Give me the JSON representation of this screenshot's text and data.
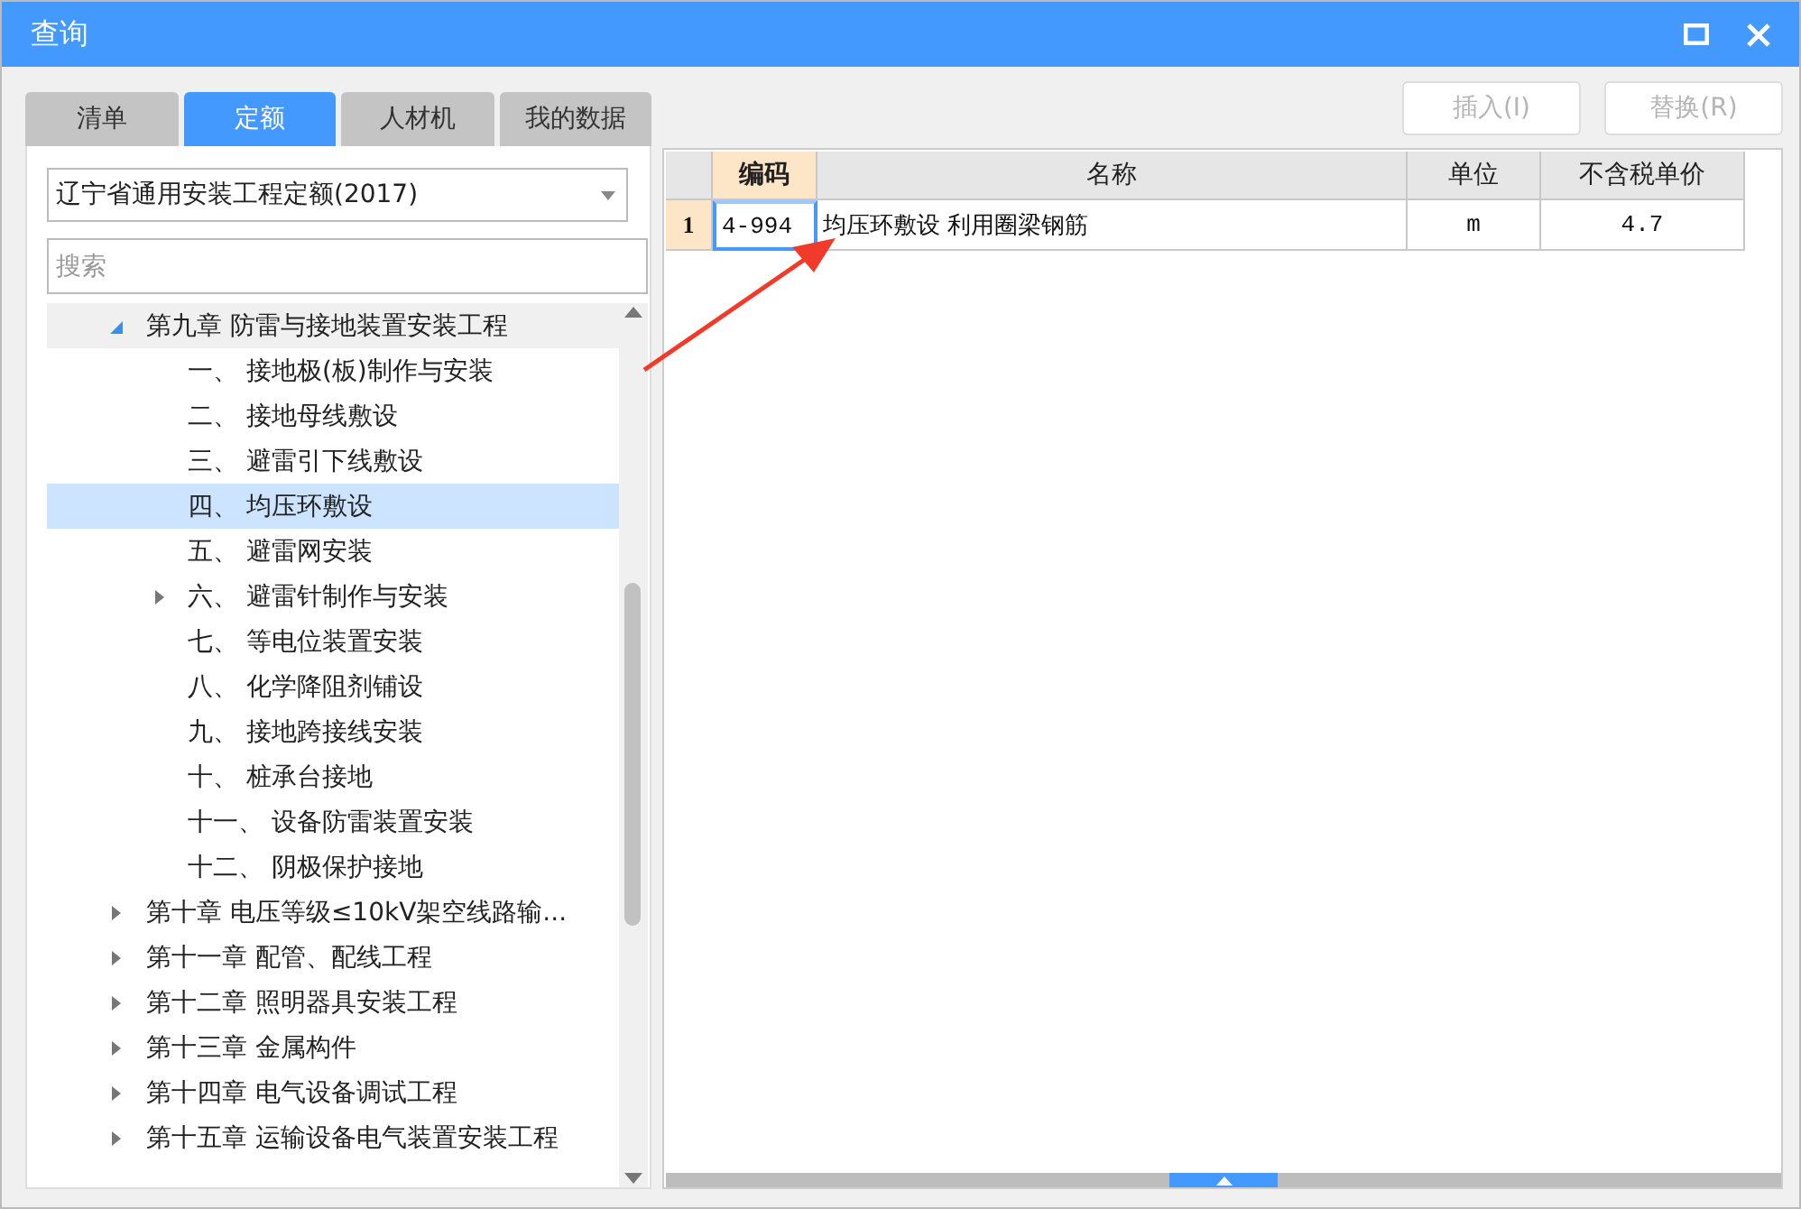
{
  "window": {
    "title": "查询"
  },
  "tabs": [
    {
      "label": "清单",
      "selected": false
    },
    {
      "label": "定额",
      "selected": true
    },
    {
      "label": "人材机",
      "selected": false
    },
    {
      "label": "我的数据",
      "selected": false
    }
  ],
  "buttons": [
    {
      "label": "插入(I)",
      "disabled": true
    },
    {
      "label": "替换(R)",
      "disabled": true
    }
  ],
  "library": {
    "value": "辽宁省通用安装工程定额(2017)"
  },
  "search": {
    "placeholder": "搜索"
  },
  "tree": [
    {
      "label": "第九章 防雷与接地装置安装工程",
      "expanded": true,
      "selected": false,
      "children": [
        {
          "label": "一、 接地极(板)制作与安装",
          "selected": false
        },
        {
          "label": "二、 接地母线敷设",
          "selected": false
        },
        {
          "label": "三、 避雷引下线敷设",
          "selected": false
        },
        {
          "label": "四、 均压环敷设",
          "selected": true
        },
        {
          "label": "五、 避雷网安装",
          "selected": false
        },
        {
          "label": "六、 避雷针制作与安装",
          "selected": false,
          "expanded": false
        },
        {
          "label": "七、 等电位装置安装",
          "selected": false
        },
        {
          "label": "八、 化学降阻剂铺设",
          "selected": false
        },
        {
          "label": "九、 接地跨接线安装",
          "selected": false
        },
        {
          "label": "十、 桩承台接地",
          "selected": false
        },
        {
          "label": "十一、 设备防雷装置安装",
          "selected": false
        },
        {
          "label": "十二、 阴极保护接地",
          "selected": false
        }
      ]
    },
    {
      "label": "第十章 电压等级≤10kV架空线路输...",
      "expanded": false,
      "selected": false
    },
    {
      "label": "第十一章 配管、配线工程",
      "expanded": false,
      "selected": false
    },
    {
      "label": "第十二章 照明器具安装工程",
      "expanded": false,
      "selected": false
    },
    {
      "label": "第十三章 金属构件",
      "expanded": false,
      "selected": false
    },
    {
      "label": "第十四章 电气设备调试工程",
      "expanded": false,
      "selected": false
    },
    {
      "label": "第十五章 运输设备电气装置安装工程",
      "expanded": false,
      "selected": false
    }
  ],
  "table": {
    "columns": [
      "编码",
      "名称",
      "单位",
      "不含税单价"
    ],
    "rows": [
      {
        "index": "1",
        "cells": [
          "4-994",
          "均压环敷设 利用圈梁钢筋",
          "m",
          "4.7"
        ]
      }
    ]
  }
}
